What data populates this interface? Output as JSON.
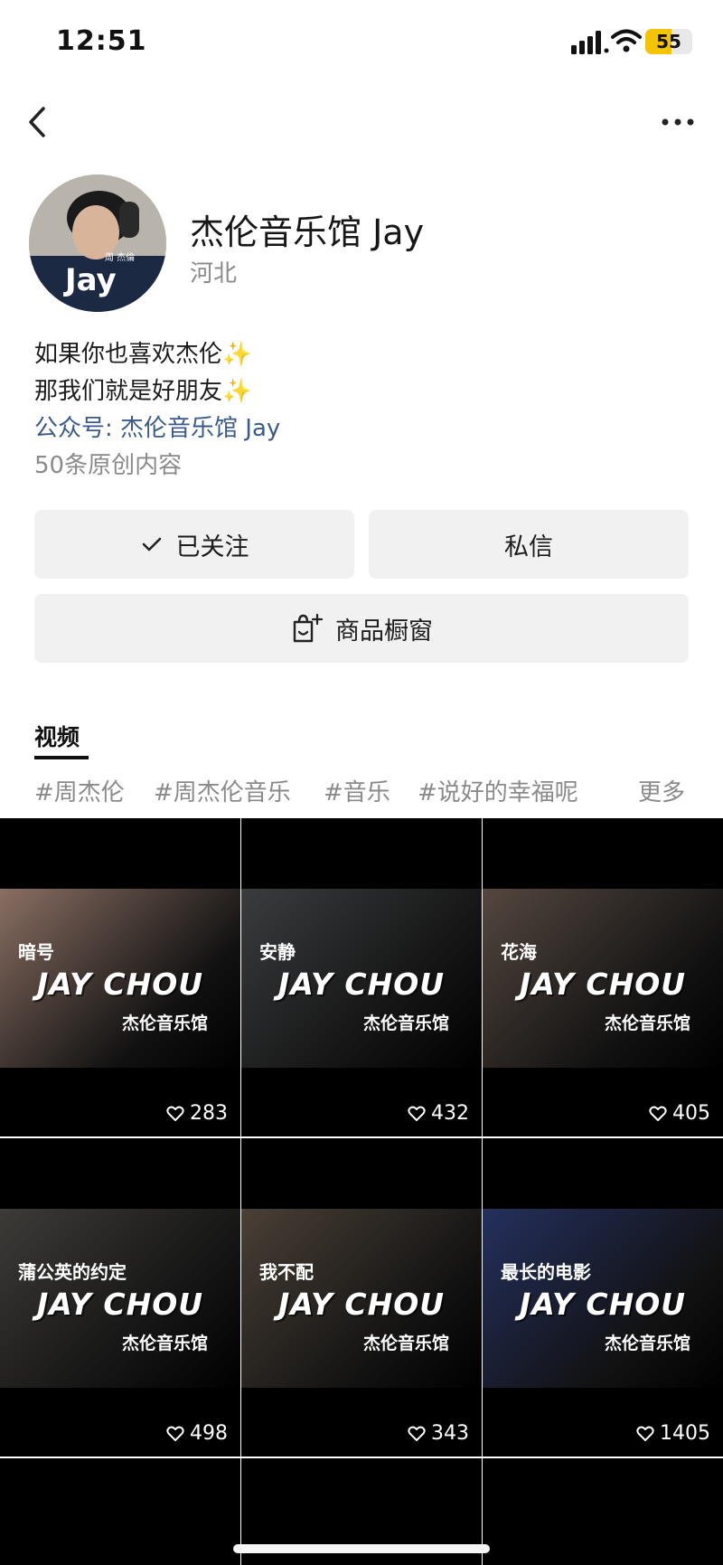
{
  "status_bar": {
    "time": "12:51",
    "battery": "55",
    "battery_level": 0.55
  },
  "profile": {
    "name": "杰伦音乐馆 Jay",
    "location": "河北",
    "bio_line1": "如果你也喜欢杰伦",
    "bio_line2": "那我们就是好朋友",
    "sparkle": "✨",
    "official_account": "公众号: 杰伦音乐馆 Jay",
    "original_count": "50条原创内容",
    "avatar_text": "Jay",
    "avatar_sub": "周 杰倫"
  },
  "actions": {
    "follow_label": "已关注",
    "message_label": "私信",
    "shop_label": "商品橱窗"
  },
  "tabs": {
    "video_label": "视频"
  },
  "tags": [
    "#周杰伦",
    "#周杰伦音乐",
    "#音乐",
    "#说好的幸福呢",
    "更多"
  ],
  "videos": [
    {
      "song": "暗号",
      "brand": "JAY CHOU",
      "sub": "杰伦音乐馆",
      "likes": "283",
      "tone": "#8a6f63"
    },
    {
      "song": "安静",
      "brand": "JAY CHOU",
      "sub": "杰伦音乐馆",
      "likes": "432",
      "tone": "#3a3c3e"
    },
    {
      "song": "花海",
      "brand": "JAY CHOU",
      "sub": "杰伦音乐馆",
      "likes": "405",
      "tone": "#54473f"
    },
    {
      "song": "蒲公英的约定",
      "brand": "JAY CHOU",
      "sub": "杰伦音乐馆",
      "likes": "498",
      "tone": "#3d3b38"
    },
    {
      "song": "我不配",
      "brand": "JAY CHOU",
      "sub": "杰伦音乐馆",
      "likes": "343",
      "tone": "#4a4036"
    },
    {
      "song": "最长的电影",
      "brand": "JAY CHOU",
      "sub": "杰伦音乐馆",
      "likes": "1405",
      "tone": "#24305e"
    }
  ],
  "colors": {
    "link": "#3a5a8c",
    "sparkle": "#f3c640",
    "button_bg": "#f1f1f1",
    "muted": "#8a8a8a"
  }
}
